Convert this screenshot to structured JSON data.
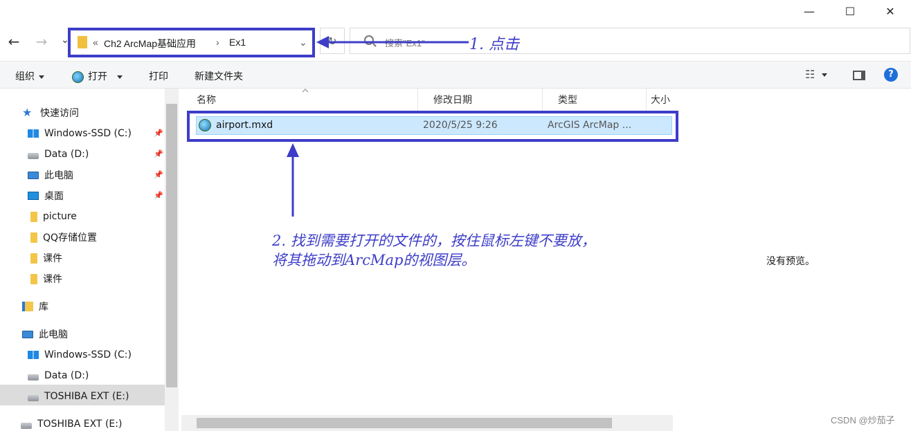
{
  "window": {
    "minimize_glyph": "—",
    "maximize_glyph": "☐",
    "close_glyph": "✕"
  },
  "nav": {
    "back_glyph": "←",
    "forward_glyph": "→",
    "recent_glyph": "⌄"
  },
  "address": {
    "chevron_left": "«",
    "segment1": "Ch2  ArcMap基础应用",
    "separator": "›",
    "segment2": "Ex1",
    "dropdown_glyph": "⌄"
  },
  "refresh": {
    "glyph": "↻"
  },
  "search": {
    "placeholder": "搜索\"Ex1\""
  },
  "toolbar": {
    "organize": "组织",
    "open": "打开",
    "print": "打印",
    "new_folder": "新建文件夹",
    "views_glyph": "☷",
    "pane_glyph": "▭",
    "help_glyph": "?"
  },
  "sidebar": {
    "quick_access": "快速访问",
    "items": [
      {
        "label": "Windows-SSD (C:)",
        "pinned": true
      },
      {
        "label": "Data (D:)",
        "pinned": true
      },
      {
        "label": "此电脑",
        "pinned": true
      },
      {
        "label": "桌面",
        "pinned": true
      },
      {
        "label": "picture",
        "pinned": false
      },
      {
        "label": "QQ存储位置",
        "pinned": false
      },
      {
        "label": "课件",
        "pinned": false
      },
      {
        "label": "课件",
        "pinned": false
      }
    ],
    "library": "库",
    "this_pc": "此电脑",
    "pc_items": [
      {
        "label": "Windows-SSD (C:)"
      },
      {
        "label": "Data (D:)"
      },
      {
        "label": "TOSHIBA EXT (E:)"
      }
    ],
    "external": "TOSHIBA EXT (E:)",
    "pin_glyph": "📌"
  },
  "columns": {
    "name": "名称",
    "modified": "修改日期",
    "type": "类型",
    "size": "大小"
  },
  "files": [
    {
      "name": "airport.mxd",
      "modified": "2020/5/25 9:26",
      "type": "ArcGIS ArcMap ..."
    }
  ],
  "preview": {
    "empty_text": "没有预览。"
  },
  "annotations": {
    "step1": "1. 点击",
    "step2_line1": "2. 找到需要打开的文件的，按住鼠标左键不要放，",
    "step2_line2": "将其拖动到ArcMap的视图层。"
  },
  "watermark": "CSDN @炒茄子",
  "colors": {
    "annotation": "#3d3dc8",
    "selection": "#cce8ff"
  }
}
